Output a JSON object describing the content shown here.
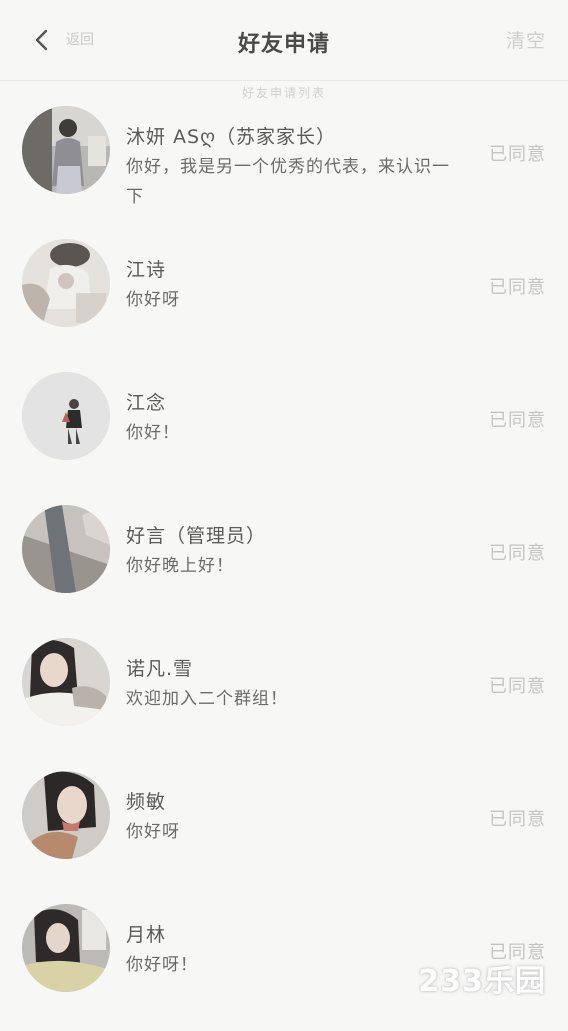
{
  "header": {
    "back_text": "返回",
    "title": "好友申请",
    "right_action": "清空",
    "subtitle": "好友申请列表"
  },
  "requests": [
    {
      "name": "沐妍 ASღ（苏家家长）",
      "message": "你好，我是另一个优秀的代表，来认识一下",
      "status": "已同意",
      "avatar": "avatar-1"
    },
    {
      "name": "江诗",
      "message": "你好呀",
      "status": "已同意",
      "avatar": "avatar-2"
    },
    {
      "name": "江念",
      "message": "你好！",
      "status": "已同意",
      "avatar": "avatar-3"
    },
    {
      "name": "好言（管理员）",
      "message": "你好晚上好！",
      "status": "已同意",
      "avatar": "avatar-4"
    },
    {
      "name": "诺凡.雪",
      "message": "欢迎加入二个群组！",
      "status": "已同意",
      "avatar": "avatar-5"
    },
    {
      "name": "频敏",
      "message": "你好呀",
      "status": "已同意",
      "avatar": "avatar-6"
    },
    {
      "name": "月林",
      "message": "你好呀！",
      "status": "已同意",
      "avatar": "avatar-7"
    }
  ],
  "watermark": "233乐园",
  "colors": {
    "background": "#f7f7f6",
    "status_text": "#c4c4c4",
    "divider": "#e9e9e7"
  }
}
